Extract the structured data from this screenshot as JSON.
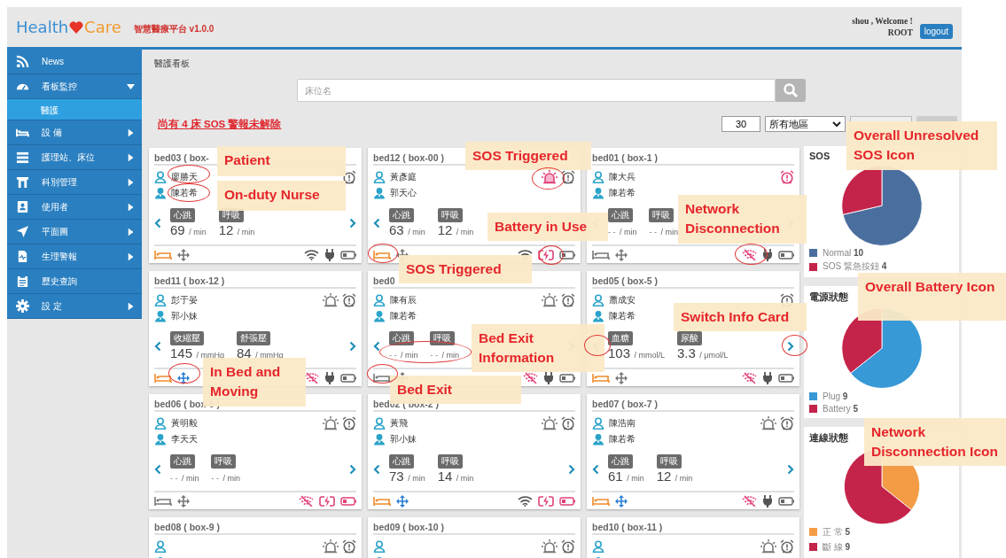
{
  "header": {
    "logo": {
      "first": "Health",
      "second": "Care"
    },
    "subtitle": "智慧醫療平台 v1.0.0",
    "user": "shou , Welcome !",
    "role": "ROOT",
    "logout": "logout"
  },
  "sidebar": {
    "items": [
      {
        "label": "News",
        "selected": false
      },
      {
        "label": "看板監控",
        "selected": false,
        "expanded": true,
        "children": [
          {
            "label": "醫護",
            "selected": true
          }
        ]
      },
      {
        "label": "設 備",
        "selected": false,
        "expanded": false
      },
      {
        "label": "護理站、床位",
        "selected": false,
        "expanded": false
      },
      {
        "label": "科別管理",
        "selected": false,
        "expanded": false
      },
      {
        "label": "使用者",
        "selected": false,
        "expanded": false
      },
      {
        "label": "平面圖",
        "selected": false,
        "expanded": false
      },
      {
        "label": "生理警報",
        "selected": false,
        "expanded": false
      },
      {
        "label": "歷史查詢",
        "selected": false
      },
      {
        "label": "設 定",
        "selected": false,
        "expanded": false
      }
    ]
  },
  "breadcrumb": "醫護看板",
  "search": {
    "placeholder": "床位名"
  },
  "alert": "尚有 4 床 SOS 警報未解除",
  "filters": {
    "count": "30",
    "region": "所有地區"
  },
  "cards": [
    {
      "title": "bed03 ( box-",
      "patient": "廖勝天",
      "nurse": "陳若希",
      "alarm": false,
      "vitals": [
        {
          "label": "心跳",
          "value": "69",
          "unit": "/ min",
          "missing": false
        },
        {
          "label": "呼吸",
          "value": "12",
          "unit": "/ min",
          "missing": false
        }
      ],
      "in_bed": true,
      "moving": false,
      "connected": true,
      "on_battery": false,
      "battery_low": false
    },
    {
      "title": "bed12 ( box-00 )",
      "patient": "黃彥庭",
      "nurse": "郭天心",
      "sos_triggered": true,
      "alarm": false,
      "vitals": [
        {
          "label": "心跳",
          "value": "63",
          "unit": "/ min",
          "missing": false
        },
        {
          "label": "呼吸",
          "value": "12",
          "unit": "/ min",
          "missing": false
        }
      ],
      "in_bed": true,
      "moving": false,
      "connected": true,
      "on_battery": true,
      "battery_low": false
    },
    {
      "title": "bed01 ( box-1 )",
      "patient": "陳大兵",
      "nurse": "陳若希",
      "alarm": true,
      "vitals": [
        {
          "label": "心跳",
          "value": "- -",
          "unit": "/ min",
          "missing": true
        },
        {
          "label": "呼吸",
          "value": "- -",
          "unit": "/ min",
          "missing": true
        }
      ],
      "in_bed": false,
      "moving": false,
      "connected": false,
      "on_battery": false,
      "battery_low": false
    },
    {
      "title": "bed11 ( box-12 )",
      "patient": "彭于晏",
      "nurse": "郭小妹",
      "sos_triggered": false,
      "alarm": false,
      "vitals": [
        {
          "label": "收縮壓",
          "value": "145",
          "unit": "/ mmHg",
          "missing": false
        },
        {
          "label": "舒張壓",
          "value": "84",
          "unit": "/ mmHg",
          "missing": false
        }
      ],
      "in_bed": true,
      "moving": true,
      "connected": false,
      "on_battery": false,
      "battery_low": false
    },
    {
      "title": "bed0",
      "patient": "陳有辰",
      "nurse": "陳若希",
      "sos_triggered": false,
      "alarm": false,
      "vitals": [
        {
          "label": "心跳",
          "value": "- -",
          "unit": "/ min",
          "missing": true
        },
        {
          "label": "呼吸",
          "value": "- -",
          "unit": "/ min",
          "missing": true
        }
      ],
      "in_bed": false,
      "moving": false,
      "connected": false,
      "on_battery": false,
      "battery_low": false
    },
    {
      "title": "bed05 ( box-5 )",
      "patient": "蕭成安",
      "nurse": "陳若希",
      "alarm": false,
      "vitals": [
        {
          "label": "血糖",
          "value": "103",
          "unit": "/ mmol/L",
          "missing": false
        },
        {
          "label": "尿酸",
          "value": "3.3",
          "unit": "/ μmol/L",
          "missing": false
        }
      ],
      "in_bed": true,
      "moving": false,
      "connected": false,
      "on_battery": false,
      "battery_low": false
    },
    {
      "title": "bed06 ( box-6 )",
      "patient": "黃明毅",
      "nurse": "李天天",
      "sos_triggered": false,
      "alarm": false,
      "vitals": [
        {
          "label": "心跳",
          "value": "- -",
          "unit": "/ min",
          "missing": true
        },
        {
          "label": "呼吸",
          "value": "- -",
          "unit": "/ min",
          "missing": true
        }
      ],
      "in_bed": false,
      "moving": false,
      "connected": false,
      "on_battery": true,
      "battery_low": true
    },
    {
      "title": "bed02 ( box-2 )",
      "patient": "黃飛",
      "nurse": "郭小妹",
      "sos_triggered": false,
      "alarm": false,
      "vitals": [
        {
          "label": "心跳",
          "value": "73",
          "unit": "/ min",
          "missing": false
        },
        {
          "label": "呼吸",
          "value": "14",
          "unit": "/ min",
          "missing": false
        }
      ],
      "in_bed": true,
      "moving": true,
      "connected": true,
      "on_battery": true,
      "battery_low": true
    },
    {
      "title": "bed07 ( box-7 )",
      "patient": "陳浩南",
      "nurse": "陳若希",
      "sos_triggered": false,
      "alarm": false,
      "vitals": [
        {
          "label": "心跳",
          "value": "61",
          "unit": "/ min",
          "missing": false
        },
        {
          "label": "呼吸",
          "value": "12",
          "unit": "/ min",
          "missing": false
        }
      ],
      "in_bed": true,
      "moving": true,
      "connected": false,
      "on_battery": false,
      "battery_low": false
    },
    {
      "title": "bed08 ( box-9 )",
      "sos_triggered": false,
      "alarm": false
    },
    {
      "title": "bed09 ( box-10 )",
      "sos_triggered": false,
      "alarm": false
    },
    {
      "title": "bed10 ( box-11 )",
      "sos_triggered": false,
      "alarm": false
    }
  ],
  "panels": [
    {
      "title": "SOS",
      "chart_data": {
        "type": "pie",
        "categories": [
          "Normal",
          "SOS 緊急按鈕"
        ],
        "values": [
          71.4,
          28.6
        ]
      },
      "legend": [
        {
          "count": "10",
          "color": "#4a6f9e"
        },
        {
          "count": "4",
          "color": "#c4234a"
        }
      ]
    },
    {
      "title": "電源狀態",
      "chart_data": {
        "type": "pie",
        "categories": [
          "Plug",
          "Battery"
        ],
        "values": [
          64.3,
          35.7
        ]
      },
      "legend": [
        {
          "count": "9",
          "color": "#3799d6"
        },
        {
          "count": "5",
          "color": "#c4234a"
        }
      ]
    },
    {
      "title": "連線狀態",
      "chart_data": {
        "type": "pie",
        "categories": [
          "正 常",
          "斷 線"
        ],
        "values": [
          35.7,
          64.3
        ]
      },
      "legend": [
        {
          "count": "5",
          "color": "#f39c45"
        },
        {
          "count": "9",
          "color": "#c4234a"
        }
      ]
    }
  ],
  "annotations": [
    {
      "text": "Patient"
    },
    {
      "text": "On-duty Nurse"
    },
    {
      "text": "SOS Triggered"
    },
    {
      "text": "Overall Unresolved SOS Icon"
    },
    {
      "text": "Battery in Use"
    },
    {
      "text": "Network Disconnection"
    },
    {
      "text": "SOS Triggered"
    },
    {
      "text": "Overall Battery Icon"
    },
    {
      "text": "Switch Info Card"
    },
    {
      "text": "Bed Exit Information"
    },
    {
      "text": "In Bed and Moving"
    },
    {
      "text": "Bed Exit"
    },
    {
      "text": "Network Disconnection Icon"
    }
  ]
}
